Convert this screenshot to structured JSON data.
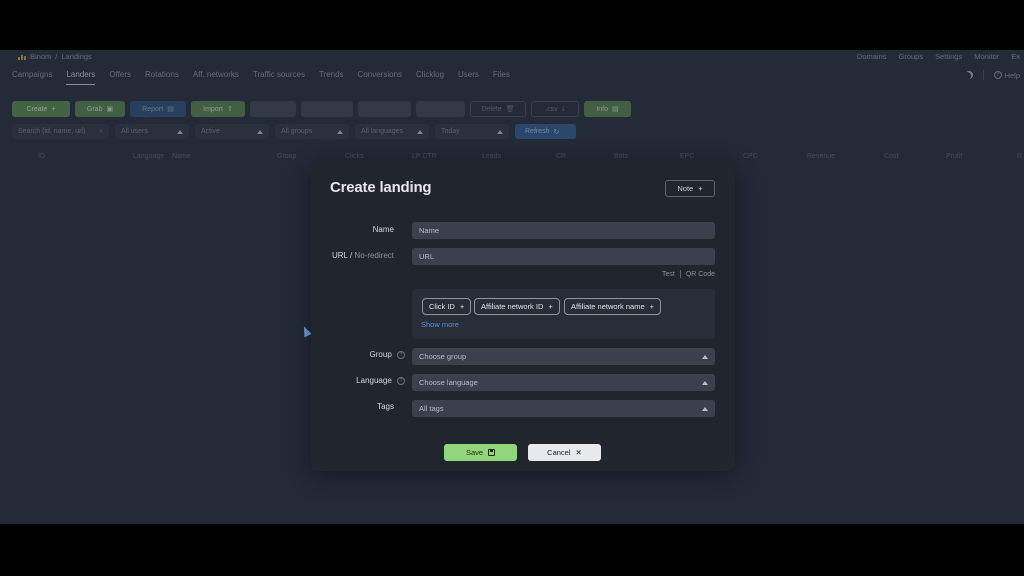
{
  "breadcrumb": {
    "app": "Binom",
    "page": "Landings"
  },
  "top_links": [
    "Domains",
    "Groups",
    "Settings",
    "Monitor",
    "Ex"
  ],
  "nav_tabs": [
    "Campaigns",
    "Landers",
    "Offers",
    "Rotations",
    "Aff. networks",
    "Traffic sources",
    "Trends",
    "Conversions",
    "Clicklog",
    "Users",
    "Files"
  ],
  "active_tab": "Landers",
  "help_label": "Help",
  "toolbar": {
    "create": "Create",
    "grab": "Grab",
    "report": "Report",
    "import": "Import",
    "delete": "Delete",
    "csv": ".csv",
    "info": "Info"
  },
  "filters": {
    "search_placeholder": "Search (id, name, url)",
    "users": "All users",
    "status": "Active",
    "groups": "All groups",
    "languages": "All languages",
    "date": "Today",
    "refresh": "Refresh"
  },
  "table_headers": [
    "ID",
    "Language",
    "Name",
    "Group",
    "Clicks",
    "LP CTR",
    "Leads",
    "CR",
    "Bots",
    "EPC",
    "CPC",
    "Revenue",
    "Cost",
    "Profit",
    "R"
  ],
  "modal": {
    "title": "Create landing",
    "note_button": "Note",
    "name_label": "Name",
    "name_placeholder": "Name",
    "url_label": "URL",
    "url_sep": "/",
    "no_redirect_label": "No-redirect",
    "url_placeholder": "URL",
    "test_link": "Test",
    "qr_code_link": "QR Code",
    "tokens": [
      "Click ID",
      "Affiliate network ID",
      "Affiliate network name"
    ],
    "show_more": "Show more",
    "group_label": "Group",
    "group_value": "Choose group",
    "language_label": "Language",
    "language_value": "Choose language",
    "tags_label": "Tags",
    "tags_value": "All tags",
    "save_button": "Save",
    "cancel_button": "Cancel"
  }
}
